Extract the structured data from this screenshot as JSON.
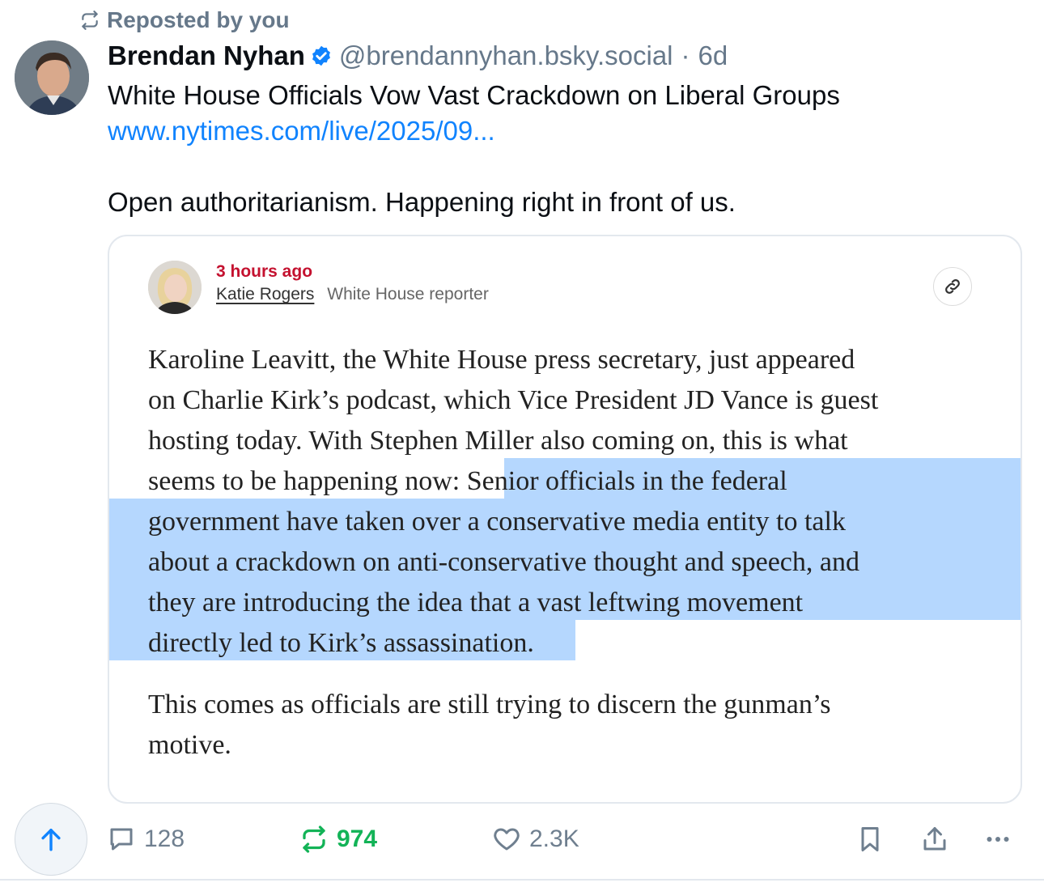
{
  "repost_header": {
    "label": "Reposted by you",
    "icon": "repost-icon"
  },
  "author": {
    "name": "Brendan Nyhan",
    "verified_icon": "verified-badge-icon",
    "handle": "@brendannyhan.bsky.social",
    "separator": "·",
    "age": "6d"
  },
  "post": {
    "headline": "White House Officials Vow Vast Crackdown on Liberal Groups",
    "link": "www.nytimes.com/live/2025/09...",
    "comment": "Open authoritarianism. Happening right in front of us."
  },
  "embed": {
    "timestamp": "3 hours ago",
    "reporter_name": "Katie Rogers",
    "reporter_role": "White House reporter",
    "link_icon": "link-icon",
    "para1_lines": [
      "Karoline Leavitt, the White House press secretary, just appeared",
      "on Charlie Kirk’s podcast, which Vice President JD Vance is guest",
      "hosting today. With Stephen Miller also coming on, this is what"
    ],
    "para1_line4_plain": "seems to be happening now: ",
    "para1_line4_highlight": "Senior officials in the federal",
    "para1_highlight_lines": [
      "government have taken over a conservative media entity to talk",
      "about a crackdown on anti-conservative thought and speech, and",
      "they are introducing the idea that a vast leftwing movement",
      "directly led to Kirk’s assassination."
    ],
    "para2_lines": [
      "This comes as officials are still trying to discern the gunman’s",
      "motive."
    ],
    "highlight_color": "#b5d7fe"
  },
  "actions": {
    "scroll_top_icon": "arrow-up-icon",
    "replies": "128",
    "reposts": "974",
    "likes": "2.3K",
    "bookmark_icon": "bookmark-icon",
    "share_icon": "share-icon",
    "more_icon": "more-icon"
  },
  "colors": {
    "link": "#1083fe",
    "muted": "#66788a",
    "repost_active": "#13b357",
    "timestamp_red": "#c4112f"
  }
}
